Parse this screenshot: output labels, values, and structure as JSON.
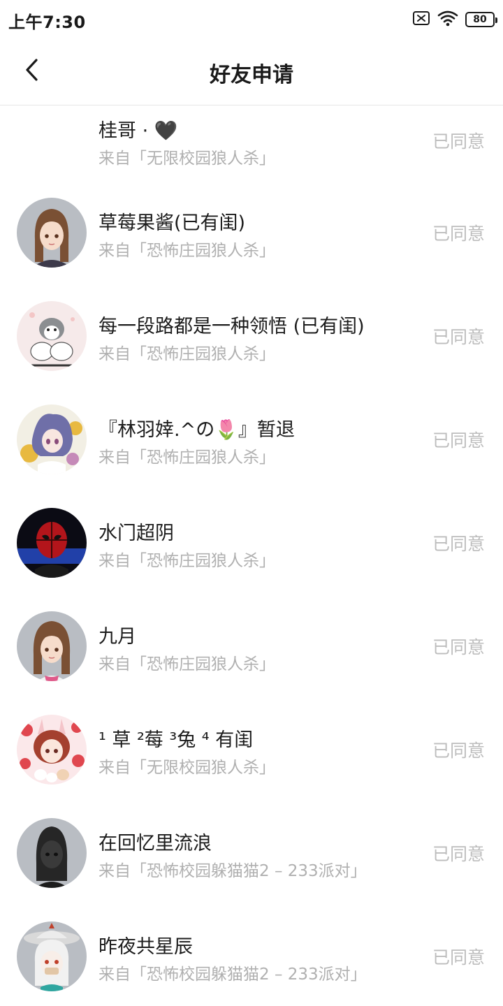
{
  "status_bar": {
    "time": "上午7:30",
    "battery": "80",
    "icons": [
      "sim-off-icon",
      "wifi-icon",
      "battery-icon"
    ]
  },
  "header": {
    "title": "好友申请",
    "back_icon": "chevron-left-icon"
  },
  "requests": [
    {
      "name": "桂哥 · 🖤",
      "source": "来自「无限校园狼人杀」",
      "status": "已同意"
    },
    {
      "name": "草莓果酱(已有闺)",
      "source": "来自「恐怖庄园狼人杀」",
      "status": "已同意"
    },
    {
      "name": "每一段路都是一种领悟 (已有闺)",
      "source": "来自「恐怖庄园狼人杀」",
      "status": "已同意"
    },
    {
      "name": "『林羽婞.^の🌷』暂退",
      "source": "来自「恐怖庄园狼人杀」",
      "status": "已同意"
    },
    {
      "name": "水门超阴",
      "source": "来自「恐怖庄园狼人杀」",
      "status": "已同意"
    },
    {
      "name": "九月",
      "source": "来自「恐怖庄园狼人杀」",
      "status": "已同意"
    },
    {
      "name": "¹ 草 ²莓  ³兔 ⁴ 有闺",
      "source": "来自「无限校园狼人杀」",
      "status": "已同意"
    },
    {
      "name": "在回忆里流浪",
      "source": "来自「恐怖校园躲猫猫2 – 233派对」",
      "status": "已同意"
    },
    {
      "name": "昨夜共星辰",
      "source": "来自「恐怖校园躲猫猫2 – 233派对」",
      "status": "已同意"
    }
  ],
  "colors": {
    "title_text": "#1a1a1a",
    "name_text": "#1c1c1c",
    "source_text": "#b0b0b0",
    "status_text": "#bdbdbd",
    "divider": "#e6e6e6"
  }
}
